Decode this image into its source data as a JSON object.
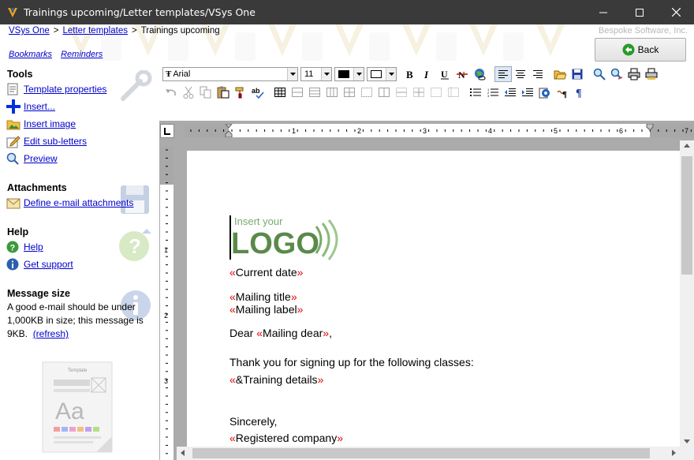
{
  "window": {
    "title": "Trainings upcoming/Letter templates/VSys One",
    "icon": "app-logo-icon"
  },
  "header": {
    "breadcrumb": [
      {
        "label": "VSys One",
        "link": true
      },
      {
        "label": "Letter templates",
        "link": true
      },
      {
        "label": "Trainings upcoming",
        "link": false
      }
    ],
    "separator": ">",
    "company": "Bespoke Software, Inc.",
    "bookmarks": "Bookmarks",
    "reminders": "Reminders",
    "back_label": "Back"
  },
  "sidebar": {
    "tools_title": "Tools",
    "tools": [
      {
        "label": "Template properties",
        "icon": "template-icon"
      },
      {
        "label": "Insert...",
        "icon": "plus-icon"
      },
      {
        "label": "Insert image",
        "icon": "image-icon"
      },
      {
        "label": "Edit sub-letters",
        "icon": "edit-icon"
      },
      {
        "label": "Preview",
        "icon": "magnifier-icon"
      }
    ],
    "attachments_title": "Attachments",
    "attachments": [
      {
        "label": "Define e-mail attachments",
        "icon": "envelope-icon"
      }
    ],
    "help_title": "Help",
    "help": [
      {
        "label": "Help",
        "icon": "question-icon"
      },
      {
        "label": "Get support",
        "icon": "info-icon"
      }
    ],
    "message_title": "Message size",
    "message_text": "A good e-mail should be under 1,000KB in size; this message is 9KB.",
    "refresh_label": "(refresh)",
    "template_graphic_label": "Template"
  },
  "toolbar": {
    "font_name": "Arial",
    "font_size": "11"
  },
  "ruler": {
    "numbers": [
      "1",
      "2",
      "3",
      "4",
      "5",
      "6",
      "7"
    ],
    "vnumbers": [
      "1",
      "2",
      "3"
    ]
  },
  "document": {
    "logo_top": "Insert your",
    "logo_main": "LOGO",
    "lines": [
      {
        "prefix": "",
        "field": "Current date",
        "suffix": ""
      },
      {
        "prefix": "",
        "field": "Mailing title",
        "suffix": ""
      },
      {
        "prefix": "",
        "field": "Mailing label",
        "suffix": ""
      },
      {
        "prefix": "Dear ",
        "field": "Mailing dear",
        "suffix": ","
      },
      {
        "prefix": "Thank you for signing up for the following classes:",
        "field": "",
        "suffix": ""
      },
      {
        "prefix": "",
        "field": "&Training details",
        "suffix": ""
      },
      {
        "prefix": "Sincerely,",
        "field": "",
        "suffix": ""
      },
      {
        "prefix": "",
        "field": "Registered company",
        "suffix": ""
      }
    ],
    "field_open": "«",
    "field_close": "»"
  },
  "colors": {
    "titlebar": "#3a3a3a",
    "link": "#0000cc",
    "merge_field": "#e00000",
    "logo_green": "#5a8a4a"
  }
}
